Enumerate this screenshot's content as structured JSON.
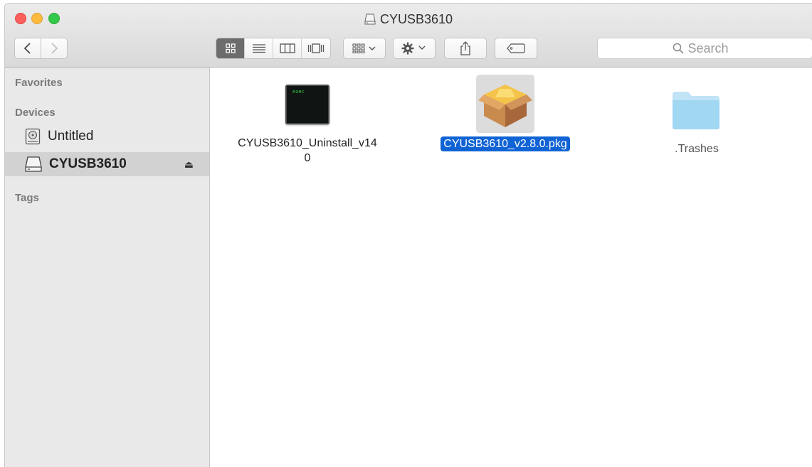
{
  "window": {
    "title": "CYUSB3610"
  },
  "toolbar": {
    "back_icon": "chevron-left-icon",
    "forward_icon": "chevron-right-icon",
    "view_icons": [
      "icon-view-icon",
      "list-view-icon",
      "column-view-icon",
      "cover-flow-icon"
    ],
    "arrange_icon": "arrange-grid-icon",
    "action_icon": "gear-icon",
    "share_icon": "share-icon",
    "tag_icon": "tag-icon",
    "search_placeholder": "Search"
  },
  "sidebar": {
    "favorites_label": "Favorites",
    "devices_label": "Devices",
    "devices": [
      {
        "label": "Untitled",
        "icon": "hard-disk-icon",
        "selected": false
      },
      {
        "label": "CYUSB3610",
        "icon": "external-drive-icon",
        "selected": true,
        "eject": "⏏"
      }
    ],
    "tags_label": "Tags"
  },
  "files": [
    {
      "name_line1": "CYUSB3610_Uninstall_v14",
      "name_line2": "0",
      "icon": "exec-terminal-icon",
      "icon_text": "exec",
      "selected": false
    },
    {
      "name": "CYUSB3610_v2.8.0.pkg",
      "icon": "package-box-icon",
      "selected": true
    },
    {
      "name": ".Trashes",
      "icon": "folder-icon",
      "selected": false,
      "dimmed": true
    }
  ],
  "colors": {
    "selection": "#1063d4",
    "sidebar_bg": "#e9e9e9",
    "folder": "#9fd5f2"
  }
}
